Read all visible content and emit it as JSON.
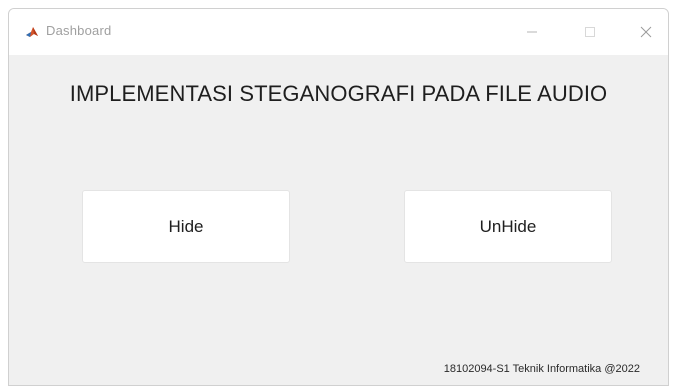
{
  "window": {
    "title": "Dashboard",
    "icon": "matlab-icon",
    "controls": {
      "minimize_icon": "minimize-icon",
      "maximize_icon": "maximize-icon",
      "close_icon": "close-icon"
    }
  },
  "main": {
    "heading": "IMPLEMENTASI STEGANOGRAFI PADA FILE AUDIO",
    "buttons": {
      "hide_label": "Hide",
      "unhide_label": "UnHide"
    },
    "footer": "18102094-S1 Teknik Informatika @2022"
  },
  "colors": {
    "window_background": "#f0f0f0",
    "titlebar_background": "#ffffff",
    "button_background": "#ffffff",
    "title_text": "#a0a0a0",
    "heading_text": "#1e1e1e"
  }
}
